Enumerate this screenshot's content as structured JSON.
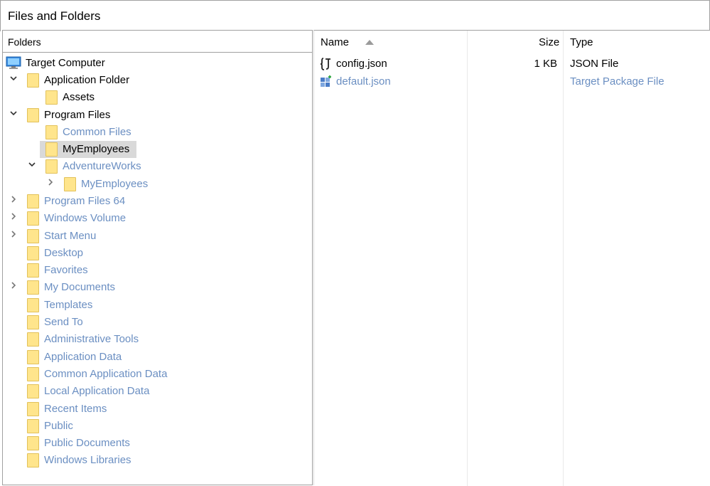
{
  "window": {
    "title": "Files and Folders"
  },
  "folders_pane": {
    "header": "Folders",
    "tree": [
      {
        "label": "Target Computer",
        "icon": "computer-icon",
        "muted": false
      },
      {
        "label": "Application Folder",
        "icon": "folder-icon",
        "muted": false,
        "chevron": "expanded"
      },
      {
        "label": "Assets",
        "icon": "folder-icon",
        "muted": false
      },
      {
        "label": "Program Files",
        "icon": "folder-icon",
        "muted": false,
        "chevron": "expanded"
      },
      {
        "label": "Common Files",
        "icon": "folder-icon",
        "muted": true
      },
      {
        "label": "MyEmployees",
        "icon": "folder-icon",
        "muted": false,
        "selected": true
      },
      {
        "label": "AdventureWorks",
        "icon": "folder-icon",
        "muted": true,
        "chevron": "expanded"
      },
      {
        "label": "MyEmployees",
        "icon": "folder-icon",
        "muted": true,
        "chevron": "collapsed"
      },
      {
        "label": "Program Files 64",
        "icon": "folder-icon",
        "muted": true,
        "chevron": "collapsed"
      },
      {
        "label": "Windows Volume",
        "icon": "folder-icon",
        "muted": true,
        "chevron": "collapsed"
      },
      {
        "label": "Start Menu",
        "icon": "folder-icon",
        "muted": true,
        "chevron": "collapsed"
      },
      {
        "label": "Desktop",
        "icon": "folder-icon",
        "muted": true
      },
      {
        "label": "Favorites",
        "icon": "folder-icon",
        "muted": true
      },
      {
        "label": "My Documents",
        "icon": "folder-icon",
        "muted": true,
        "chevron": "collapsed"
      },
      {
        "label": "Templates",
        "icon": "folder-icon",
        "muted": true
      },
      {
        "label": "Send To",
        "icon": "folder-icon",
        "muted": true
      },
      {
        "label": "Administrative Tools",
        "icon": "folder-icon",
        "muted": true
      },
      {
        "label": "Application Data",
        "icon": "folder-icon",
        "muted": true
      },
      {
        "label": "Common Application Data",
        "icon": "folder-icon",
        "muted": true
      },
      {
        "label": "Local Application Data",
        "icon": "folder-icon",
        "muted": true
      },
      {
        "label": "Recent Items",
        "icon": "folder-icon",
        "muted": true
      },
      {
        "label": "Public",
        "icon": "folder-icon",
        "muted": true
      },
      {
        "label": "Public Documents",
        "icon": "folder-icon",
        "muted": true
      },
      {
        "label": "Windows Libraries",
        "icon": "folder-icon",
        "muted": true
      }
    ]
  },
  "files_pane": {
    "columns": {
      "name": "Name",
      "size": "Size",
      "type": "Type"
    },
    "files": [
      {
        "name": "config.json",
        "size": "1 KB",
        "type": "JSON File",
        "icon": "json-file-icon",
        "muted": false
      },
      {
        "name": "default.json",
        "size": "",
        "type": "Target Package File",
        "icon": "package-file-icon",
        "muted": true
      }
    ]
  },
  "colors": {
    "muted_text": "#6b8fc2",
    "selection": "#d9d9d9",
    "folder": "#ffe58c",
    "border": "#a0a0a0"
  }
}
